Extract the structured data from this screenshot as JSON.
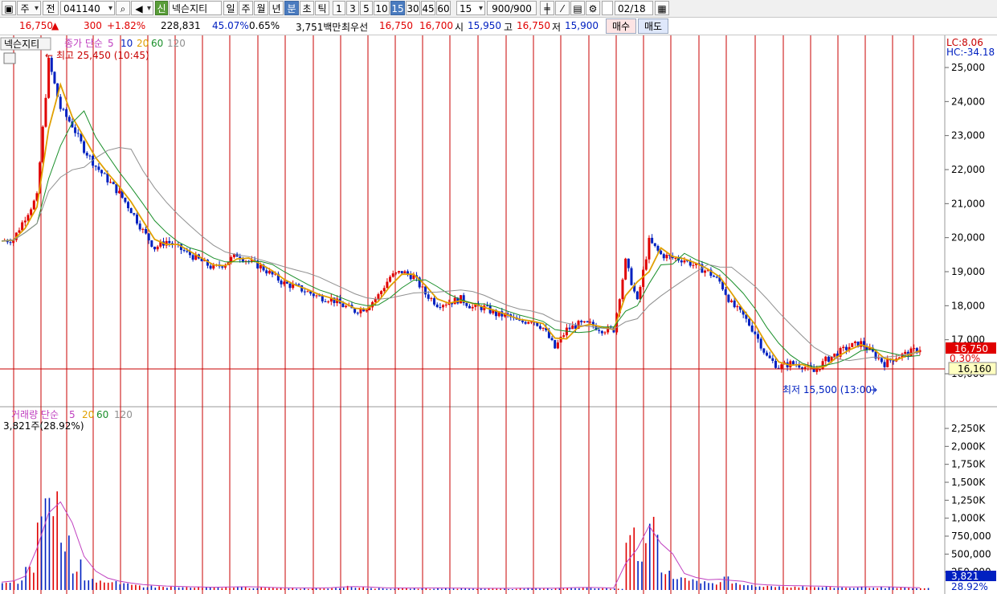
{
  "toolbar": {
    "market": "주",
    "type": "전",
    "code": "041140",
    "stock_badge": "신",
    "stock_name": "넥슨지티",
    "periods": [
      "일",
      "주",
      "월",
      "년",
      "분",
      "초",
      "틱"
    ],
    "active_period": "분",
    "intervals": [
      "1",
      "3",
      "5",
      "10",
      "15",
      "30",
      "45",
      "60"
    ],
    "active_interval": "15",
    "interval_select": "15",
    "count": "900/900",
    "date": "02/18"
  },
  "info": {
    "price": "16,750",
    "change": "300",
    "change_pct": "+1.82%",
    "volume": "228,831",
    "pct1": "45.07%",
    "pct2": "0.65%",
    "amount": "3,751백만",
    "bid_label": "최우선",
    "ask_price": "16,750",
    "bid_price": "16,700",
    "open_label": "시",
    "open": "15,950",
    "high_label": "고",
    "high": "16,750",
    "low_label": "저",
    "low": "15,900",
    "buy_label": "매수",
    "sell_label": "매도"
  },
  "colors": {
    "up": "#e00000",
    "down": "#0020c0",
    "ma5": "#e0a000",
    "ma20": "#1a8f2a",
    "ma60": "#909090",
    "grid": "#c80000"
  },
  "price_panel": {
    "name_tag": "넥슨지티",
    "legend_label": "종가 단순",
    "legend_periods": [
      "5",
      "10",
      "20",
      "60",
      "120"
    ],
    "high_note": "최고 25,450 (10:45)",
    "low_note": "최저 15,500 (13:00)",
    "lc": "LC:8.06",
    "hc": "HC:-34.18",
    "current_tag": "16,750",
    "current_pct": "0.30%",
    "cross_tag": "16,160",
    "axis_ticks": [
      "25,000",
      "24,000",
      "23,000",
      "22,000",
      "21,000",
      "20,000",
      "19,000",
      "18,000",
      "17,000",
      "16,000"
    ]
  },
  "volume_panel": {
    "legend_label": "거래량 단순",
    "legend_periods": [
      "5",
      "20",
      "60",
      "120"
    ],
    "current_volume": "3,821주(28.92%)",
    "axis_ticks": [
      "2,250K",
      "2,000K",
      "1,750K",
      "1,500K",
      "1,250K",
      "1,000K",
      "750,000",
      "500,000",
      "250,000"
    ],
    "current_tag": "3,821",
    "current_pct": "28.92%"
  },
  "chart_data": {
    "type": "line",
    "title": "",
    "series": [
      {
        "name": "종가",
        "values": [
          19900,
          19950,
          20600,
          21200,
          25200,
          23800,
          23300,
          22600,
          22100,
          21700,
          21300,
          20800,
          20200,
          19700,
          19900,
          19700,
          19500,
          19300,
          19100,
          19250,
          19500,
          19300,
          19150,
          18900,
          18650,
          18550,
          18400,
          18250,
          18200,
          18000,
          17850,
          17950,
          18300,
          18850,
          19000,
          18850,
          18350,
          18050,
          18100,
          18200,
          17950,
          17950,
          17750,
          17700,
          17500,
          17600,
          17350,
          16750,
          17300,
          17450,
          17450,
          17300,
          17300,
          19300,
          18100,
          19900,
          19500,
          19400,
          19350,
          19150,
          19000,
          18700,
          18050,
          17700,
          17200,
          16500,
          16200,
          16300,
          16250,
          16050,
          16400,
          16600,
          16800,
          16900,
          16600,
          16300,
          16500,
          16600,
          16750
        ]
      }
    ],
    "ylim": [
      15500,
      25450
    ],
    "volume_values": [
      110,
      140,
      320,
      1280,
      1620,
      780,
      410,
      220,
      160,
      120,
      90,
      80,
      60,
      55,
      50,
      45,
      40,
      40,
      35,
      45,
      50,
      40,
      35,
      30,
      30,
      28,
      26,
      30,
      40,
      55,
      45,
      30,
      28,
      25,
      30,
      28,
      26,
      30,
      25,
      24,
      22,
      24,
      26,
      20,
      30,
      26,
      22,
      30,
      35,
      40,
      30,
      26,
      25,
      1050,
      650,
      980,
      320,
      210,
      160,
      150,
      120,
      180,
      100,
      80,
      70,
      65,
      60,
      55,
      60,
      50,
      45,
      40,
      40,
      50,
      45,
      40,
      35,
      30,
      28
    ],
    "volume_ylim": [
      0,
      2500
    ]
  }
}
